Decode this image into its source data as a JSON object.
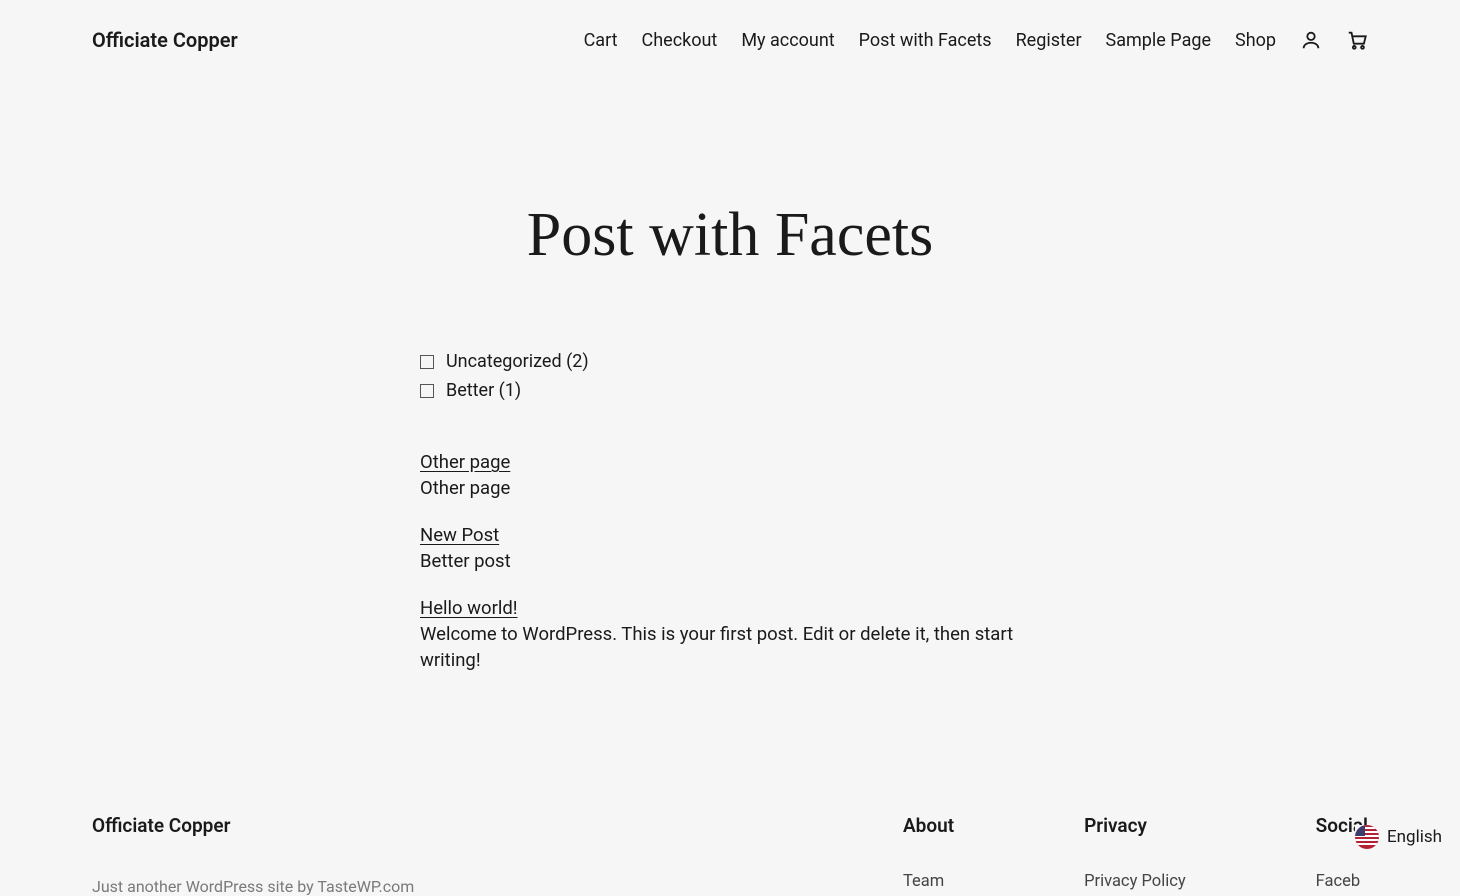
{
  "header": {
    "site_title": "Officiate Copper",
    "nav": [
      "Cart",
      "Checkout",
      "My account",
      "Post with Facets",
      "Register",
      "Sample Page",
      "Shop"
    ]
  },
  "page": {
    "title": "Post with Facets"
  },
  "facets": [
    {
      "label": "Uncategorized",
      "count": "(2)"
    },
    {
      "label": "Better",
      "count": "(1)"
    }
  ],
  "posts": [
    {
      "title": "Other page",
      "excerpt": "Other page"
    },
    {
      "title": "New Post",
      "excerpt": "Better post"
    },
    {
      "title": "Hello world!",
      "excerpt": "Welcome to WordPress. This is your first post. Edit or delete it, then start writing!"
    }
  ],
  "footer": {
    "title": "Officiate Copper",
    "tagline": "Just another WordPress site by TasteWP.com",
    "columns": [
      {
        "heading": "About",
        "link": "Team"
      },
      {
        "heading": "Privacy",
        "link": "Privacy Policy"
      },
      {
        "heading": "Social",
        "link": "Faceb"
      }
    ]
  },
  "lang": {
    "label": "English"
  }
}
